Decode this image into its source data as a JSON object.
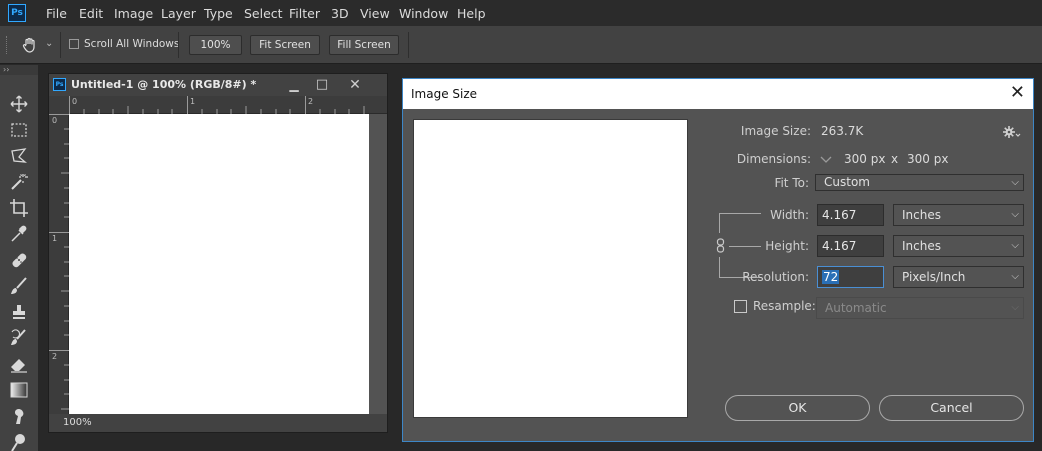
{
  "app": {
    "logo_text": "Ps",
    "menu": [
      "File",
      "Edit",
      "Image",
      "Layer",
      "Type",
      "Select",
      "Filter",
      "3D",
      "View",
      "Window",
      "Help"
    ]
  },
  "options_bar": {
    "scroll_all_windows_label": "Scroll All Windows",
    "scroll_all_windows_checked": false,
    "zoom_button": "100%",
    "fit_screen_button": "Fit Screen",
    "fill_screen_button": "Fill Screen"
  },
  "tools": [
    "move-icon",
    "marquee-icon",
    "lasso-icon",
    "magic-wand-icon",
    "crop-icon",
    "eyedropper-icon",
    "healing-icon",
    "brush-icon",
    "stamp-icon",
    "history-brush-icon",
    "eraser-icon",
    "gradient-icon",
    "smudge-icon",
    "dodge-icon"
  ],
  "document": {
    "title": "Untitled-1 @ 100% (RGB/8#) *",
    "icon_text": "Ps",
    "ruler_top": [
      "0",
      "1",
      "2"
    ],
    "ruler_left": [
      "0",
      "1",
      "2"
    ],
    "zoom": "100%"
  },
  "dialog": {
    "title": "Image Size",
    "image_size_label": "Image Size:",
    "image_size_value": "263.7K",
    "dimensions_label": "Dimensions:",
    "dim_width": "300 px",
    "dim_times": "x",
    "dim_height": "300 px",
    "fit_to_label": "Fit To:",
    "fit_to_value": "Custom",
    "width_label": "Width:",
    "width_value": "4.167",
    "width_unit": "Inches",
    "height_label": "Height:",
    "height_value": "4.167",
    "height_unit": "Inches",
    "resolution_label": "Resolution:",
    "resolution_value": "72",
    "resolution_unit": "Pixels/Inch",
    "resample_label": "Resample:",
    "resample_checked": false,
    "resample_value": "Automatic",
    "ok_button": "OK",
    "cancel_button": "Cancel",
    "colors": {
      "accent_border": "#3d86c6",
      "selection": "#2a6fb6"
    }
  }
}
